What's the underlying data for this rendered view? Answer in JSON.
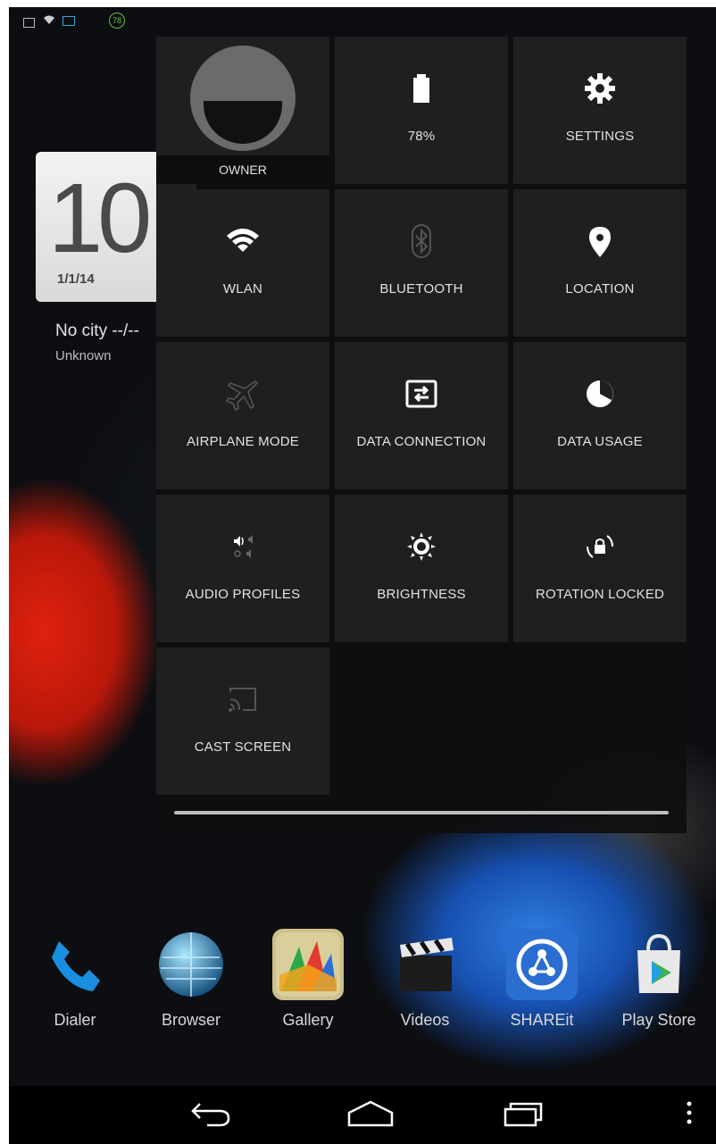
{
  "status_bar": {
    "icons": [
      "gallery-icon",
      "wifi-icon",
      "book-icon"
    ],
    "battery_badge": "78"
  },
  "clock_widget": {
    "time": "10",
    "date": "1/1/14",
    "city": "No city  --/--",
    "condition": "Unknown"
  },
  "quick_settings": {
    "tiles": [
      {
        "label": "OWNER",
        "icon": "avatar-icon"
      },
      {
        "label": "78%",
        "icon": "battery-icon"
      },
      {
        "label": "SETTINGS",
        "icon": "gear-icon"
      },
      {
        "label": "WLAN",
        "icon": "wifi-icon"
      },
      {
        "label": "BLUETOOTH",
        "icon": "bluetooth-icon"
      },
      {
        "label": "LOCATION",
        "icon": "location-pin-icon"
      },
      {
        "label": "AIRPLANE MODE",
        "icon": "airplane-icon"
      },
      {
        "label": "DATA CONNECTION",
        "icon": "data-connection-icon"
      },
      {
        "label": "DATA USAGE",
        "icon": "data-usage-icon"
      },
      {
        "label": "AUDIO PROFILES",
        "icon": "audio-profiles-icon"
      },
      {
        "label": "BRIGHTNESS",
        "icon": "brightness-icon"
      },
      {
        "label": "ROTATION LOCKED",
        "icon": "rotation-lock-icon"
      },
      {
        "label": "CAST SCREEN",
        "icon": "cast-screen-icon"
      }
    ]
  },
  "dock": {
    "apps": [
      {
        "label": "Dialer",
        "icon": "phone-icon"
      },
      {
        "label": "Browser",
        "icon": "globe-icon"
      },
      {
        "label": "Gallery",
        "icon": "gallery-icon"
      },
      {
        "label": "Videos",
        "icon": "clapperboard-icon"
      },
      {
        "label": "SHAREit",
        "icon": "share-icon"
      },
      {
        "label": "Play Store",
        "icon": "play-store-icon"
      }
    ]
  },
  "nav_bar": {
    "buttons": [
      "back-icon",
      "home-icon",
      "recents-icon",
      "menu-icon"
    ]
  }
}
